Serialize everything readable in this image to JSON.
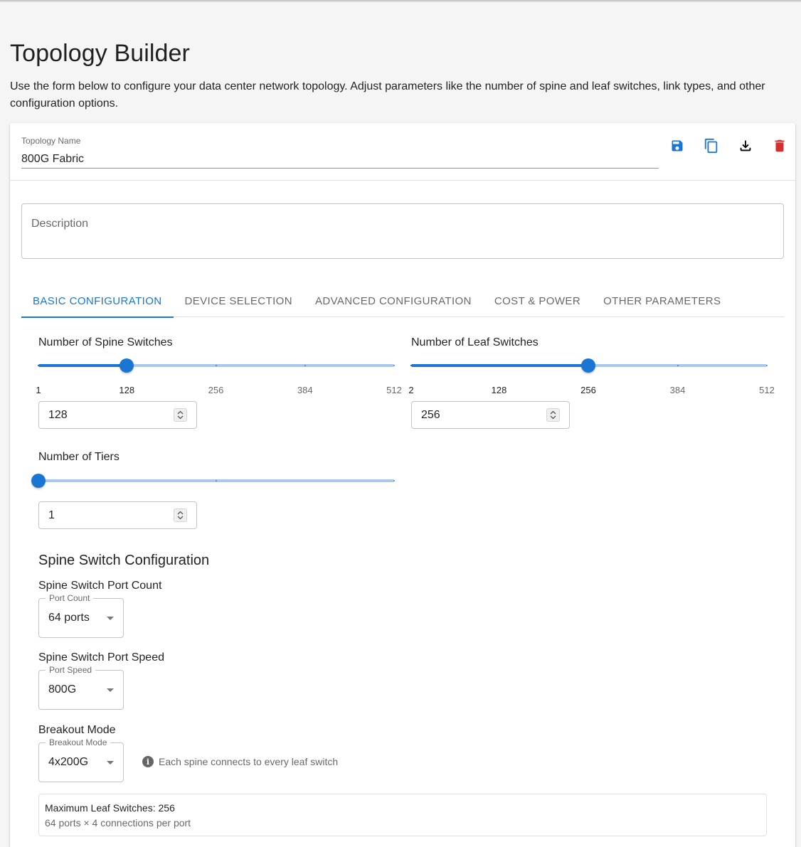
{
  "page": {
    "title": "Topology Builder",
    "intro": "Use the form below to configure your data center network topology. Adjust parameters like the number of spine and leaf switches, link types, and other configuration options."
  },
  "topology": {
    "name_label": "Topology Name",
    "name_value": "800G Fabric",
    "actions": [
      {
        "name": "save-icon",
        "color": "#1976d2"
      },
      {
        "name": "copy-icon",
        "color": "#1976d2"
      },
      {
        "name": "download-icon",
        "color": "#000000"
      },
      {
        "name": "delete-icon",
        "color": "#d32f2f"
      }
    ]
  },
  "description": {
    "placeholder": "Description"
  },
  "tabs": [
    {
      "label": "BASIC CONFIGURATION",
      "active": true
    },
    {
      "label": "DEVICE SELECTION",
      "active": false
    },
    {
      "label": "ADVANCED CONFIGURATION",
      "active": false
    },
    {
      "label": "COST & POWER",
      "active": false
    },
    {
      "label": "OTHER PARAMETERS",
      "active": false
    }
  ],
  "spine_slider": {
    "label": "Number of Spine Switches",
    "min": 1,
    "max": 512,
    "value": 128,
    "marks": [
      "1",
      "128",
      "256",
      "384",
      "512"
    ],
    "input_value": "128"
  },
  "leaf_slider": {
    "label": "Number of Leaf Switches",
    "min": 2,
    "max": 512,
    "value": 256,
    "marks": [
      "2",
      "128",
      "256",
      "384",
      "512"
    ],
    "input_value": "256"
  },
  "tiers_slider": {
    "label": "Number of Tiers",
    "min": 1,
    "max": 3,
    "value": 1,
    "input_value": "1"
  },
  "spine_config": {
    "heading": "Spine Switch Configuration",
    "port_count": {
      "title": "Spine Switch Port Count",
      "legend": "Port Count",
      "value": "64 ports"
    },
    "port_speed": {
      "title": "Spine Switch Port Speed",
      "legend": "Port Speed",
      "value": "800G"
    },
    "breakout": {
      "title": "Breakout Mode",
      "legend": "Breakout Mode",
      "value": "4x200G"
    },
    "info_text": "Each spine connects to every leaf switch"
  },
  "summary": {
    "line1": "Maximum Leaf Switches: 256",
    "line2": "64 ports × 4 connections per port"
  },
  "colors": {
    "primary": "#1976d2",
    "danger": "#d32f2f"
  }
}
